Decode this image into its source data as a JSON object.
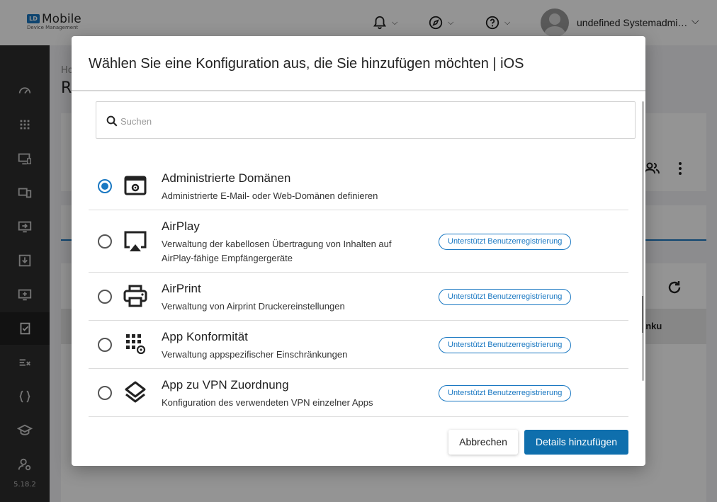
{
  "app": {
    "logo_badge": "LD",
    "logo_title": "Mobile",
    "logo_subtitle": "Device Management",
    "username": "undefined Systemadmi…",
    "version": "5.18.2"
  },
  "background": {
    "crumb": "Ho",
    "title": "R",
    "table_col": "anku"
  },
  "modal": {
    "title": "Wählen Sie eine Konfiguration aus, die Sie hinzufügen möchten | iOS",
    "search_placeholder": "Suchen",
    "items": [
      {
        "title": "Administrierte Domänen",
        "desc": "Administrierte E-Mail- oder Web-Domänen definieren",
        "badge": "",
        "selected": true,
        "icon": "domain-settings-icon"
      },
      {
        "title": "AirPlay",
        "desc": "Verwaltung der kabellosen Übertragung von Inhalten auf AirPlay-fähige Empfängergeräte",
        "badge": "Unterstützt Benutzerregistrierung",
        "selected": false,
        "icon": "airplay-icon"
      },
      {
        "title": "AirPrint",
        "desc": "Verwaltung von Airprint Druckereinstellungen",
        "badge": "Unterstützt Benutzerregistrierung",
        "selected": false,
        "icon": "printer-icon"
      },
      {
        "title": "App Konformität",
        "desc": "Verwaltung appspezifischer Einschränkungen",
        "badge": "Unterstützt Benutzerregistrierung",
        "selected": false,
        "icon": "app-grid-settings-icon"
      },
      {
        "title": "App zu VPN Zuordnung",
        "desc": "Konfiguration des verwendeten VPN einzelner Apps",
        "badge": "Unterstützt Benutzerregistrierung",
        "selected": false,
        "icon": "layers-icon"
      }
    ],
    "cancel_label": "Abbrechen",
    "confirm_label": "Details hinzufügen"
  },
  "colors": {
    "accent": "#1a78c2",
    "primary_button": "#0f6fad",
    "sidebar": "#2e2e2e"
  }
}
